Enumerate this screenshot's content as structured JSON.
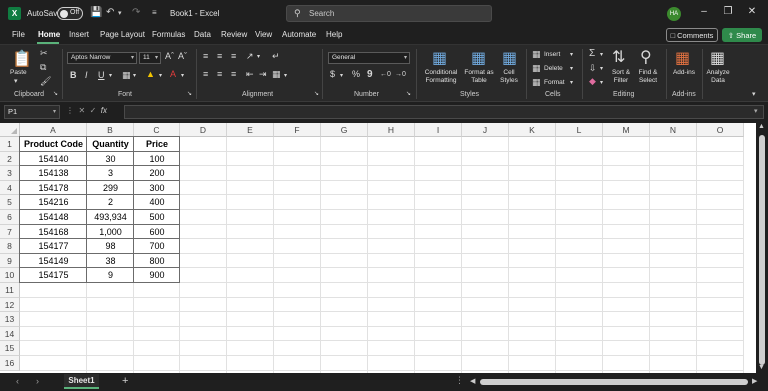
{
  "titlebar": {
    "autosave_label": "AutoSave",
    "toggle_state": "Off",
    "doc_title": "Book1  -  Excel",
    "search_placeholder": "Search",
    "user_initials": "HA"
  },
  "menu": {
    "tabs": [
      "File",
      "Home",
      "Insert",
      "Page Layout",
      "Formulas",
      "Data",
      "Review",
      "View",
      "Automate",
      "Help"
    ],
    "active": "Home",
    "comments": "Comments",
    "share": "Share"
  },
  "ribbon": {
    "groups": {
      "clipboard": "Clipboard",
      "font": "Font",
      "alignment": "Alignment",
      "number": "Number",
      "styles": "Styles",
      "cells": "Cells",
      "editing": "Editing",
      "addins": "Add-ins"
    },
    "paste": "Paste",
    "font_name": "Aptos Narrow",
    "font_size": "11",
    "number_format": "General",
    "conditional_formatting": [
      "Conditional",
      "Formatting"
    ],
    "format_as_table": [
      "Format as",
      "Table"
    ],
    "cell_styles": [
      "Cell",
      "Styles"
    ],
    "insert": "Insert",
    "delete": "Delete",
    "format": "Format",
    "sort_filter": [
      "Sort &",
      "Filter"
    ],
    "find_select": [
      "Find &",
      "Select"
    ],
    "addins_btn": "Add-ins",
    "analyze_data": [
      "Analyze",
      "Data"
    ]
  },
  "formula_bar": {
    "name_box": "P1",
    "fx": "fx",
    "content": ""
  },
  "grid": {
    "columns": [
      "A",
      "B",
      "C",
      "D",
      "E",
      "F",
      "G",
      "H",
      "I",
      "J",
      "K",
      "L",
      "M",
      "N",
      "O"
    ],
    "rows": [
      "1",
      "2",
      "3",
      "4",
      "5",
      "6",
      "7",
      "8",
      "9",
      "10",
      "11",
      "12",
      "13",
      "14",
      "15",
      "16"
    ],
    "headers": [
      "Product Code",
      "Quantity",
      "Price"
    ],
    "data": [
      [
        "154140",
        "30",
        "100"
      ],
      [
        "154138",
        "3",
        "200"
      ],
      [
        "154178",
        "299",
        "300"
      ],
      [
        "154216",
        "2",
        "400"
      ],
      [
        "154148",
        "493,934",
        "500"
      ],
      [
        "154168",
        "1,000",
        "600"
      ],
      [
        "154177",
        "98",
        "700"
      ],
      [
        "154149",
        "38",
        "800"
      ],
      [
        "154175",
        "9",
        "900"
      ]
    ]
  },
  "sheets": {
    "tabs": [
      "Sheet1"
    ],
    "active": "Sheet1"
  },
  "colors": {
    "accent": "#2f8a4b",
    "chrome": "#1f1f1f",
    "ribbon": "#292929"
  }
}
